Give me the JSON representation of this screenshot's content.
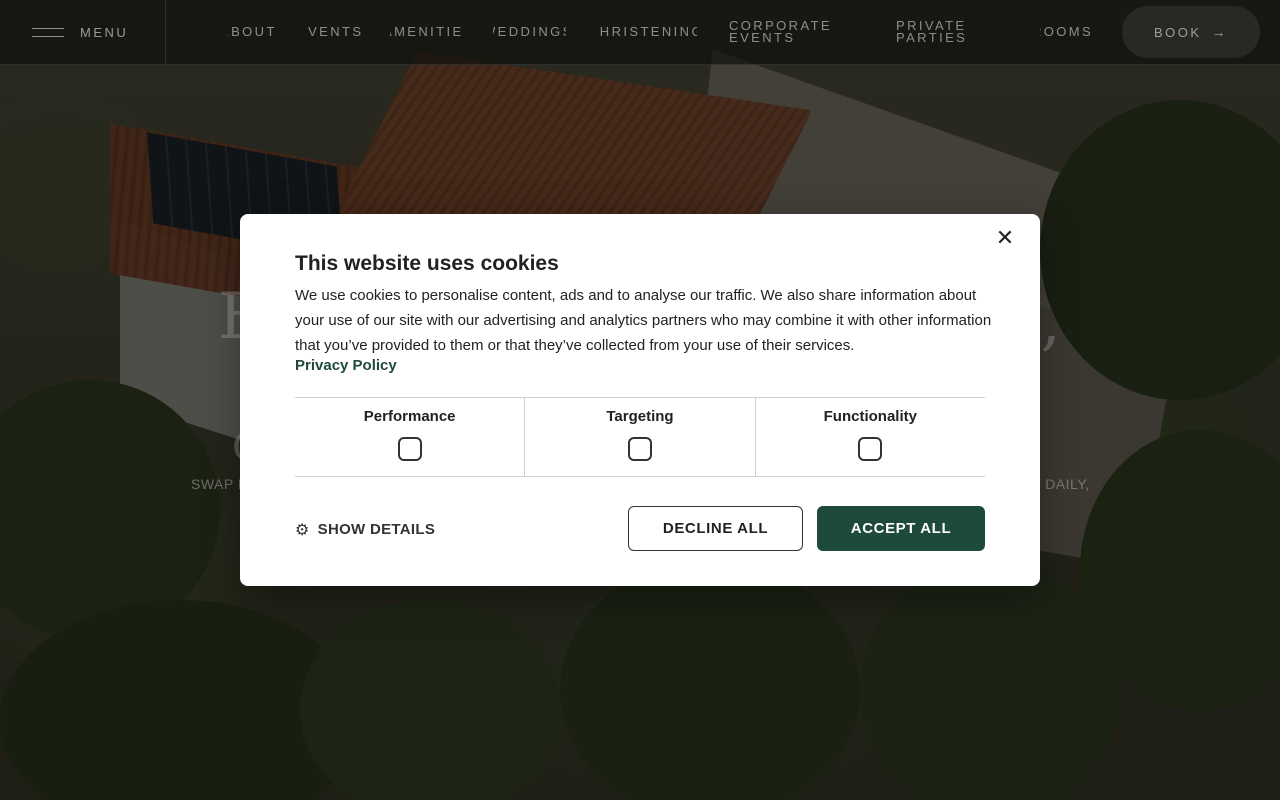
{
  "nav": {
    "menu_label": "MENU",
    "items": [
      {
        "label": "ABOUT"
      },
      {
        "label": "EVENTS"
      },
      {
        "label": "AMENITIES"
      },
      {
        "label": "WEDDINGS"
      },
      {
        "label": "CHRISTENING"
      },
      {
        "label": "CORPORATE EVENTS"
      },
      {
        "label": "PRIVATE PARTIES"
      },
      {
        "label": "ROOMS"
      }
    ],
    "book_label": "BOOK",
    "book_icon": "arrow-right-icon"
  },
  "hero": {
    "title_left": "E",
    "title_right": "l,",
    "glyph": "C",
    "subtitle_left": "SWAP E",
    "subtitle_right": "T DAILY,"
  },
  "cookie_dialog": {
    "title": "This website uses cookies",
    "body": "We use cookies to personalise content, ads and to analyse our traffic. We also share information about your use of our site with our advertising and analytics partners who may combine it with other information that you’ve provided to them or that they’ve collected from your use of their services.",
    "privacy_link": "Privacy Policy",
    "categories": [
      {
        "label": "Performance",
        "checked": false
      },
      {
        "label": "Targeting",
        "checked": false
      },
      {
        "label": "Functionality",
        "checked": false
      }
    ],
    "show_details_label": "SHOW DETAILS",
    "decline_label": "DECLINE ALL",
    "accept_label": "ACCEPT ALL",
    "close_icon": "close-icon",
    "accent_color": "#1e4a3a"
  }
}
